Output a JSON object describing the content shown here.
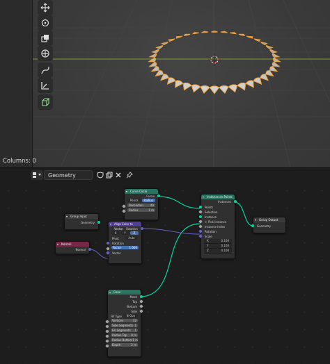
{
  "viewport": {
    "columns_label": "Columns: 0",
    "tools": [
      "move-icon",
      "rotate-icon",
      "scale-icon",
      "transform-icon",
      "annotate-icon",
      "measure-icon",
      "add-cube-icon"
    ]
  },
  "header": {
    "editor_type_icon": "node-editor-icon",
    "tree_name": "Geometry Nodes"
  },
  "nodes": {
    "curve_circle": {
      "title": "Curve Circle",
      "output": "Curve",
      "mode_options": [
        "Points",
        "Radius"
      ],
      "mode_selected": "Radius",
      "resolution_label": "Resolution",
      "resolution_value": "40",
      "radius_label": "Radius",
      "radius_value": "1 m"
    },
    "group_input": {
      "title": "Group Input",
      "output": "Geometry"
    },
    "align_euler": {
      "title": "Align Euler to Vector",
      "output": "Rotation",
      "axis_options": [
        "X",
        "Y",
        "Z"
      ],
      "axis_selected": "Z",
      "pivot_label": "Pivot",
      "pivot_value": "Auto",
      "rotation_label": "Rotation",
      "factor_label": "Factor",
      "factor_value": "1.000",
      "vector_label": "Vector"
    },
    "normal": {
      "title": "Normal",
      "output": "Normal"
    },
    "instance_on_points": {
      "title": "Instance on Points",
      "output": "Instances",
      "inputs": [
        "Points",
        "Selection",
        "Instance",
        "Pick Instance",
        "Instance Index",
        "Rotation",
        "Scale"
      ],
      "scale_values": [
        {
          "axis": "X",
          "value": "0.100"
        },
        {
          "axis": "Y",
          "value": "0.100"
        },
        {
          "axis": "Z",
          "value": "0.100"
        }
      ]
    },
    "group_output": {
      "title": "Group Output",
      "input": "Geometry"
    },
    "cone": {
      "title": "Cone",
      "outputs": [
        "Mesh",
        "Top",
        "Bottom",
        "Side"
      ],
      "fill_type_label": "Fill Type",
      "fill_type_value": "N-Gon",
      "fields": [
        {
          "label": "Vertices",
          "value": "32"
        },
        {
          "label": "Side Segments",
          "value": "1"
        },
        {
          "label": "Fill Segments",
          "value": "1"
        },
        {
          "label": "Radius Top",
          "value": "0 m"
        },
        {
          "label": "Radius Bottom",
          "value": "1 m"
        },
        {
          "label": "Depth",
          "value": "2 m"
        }
      ]
    }
  },
  "colors": {
    "geometry_link": "#00d6a3",
    "vector_link": "#6363c7",
    "selection_orange": "#f4a236",
    "header_geometry": "#2a7360",
    "header_vector": "#533d8f",
    "header_input": "#77284a"
  }
}
